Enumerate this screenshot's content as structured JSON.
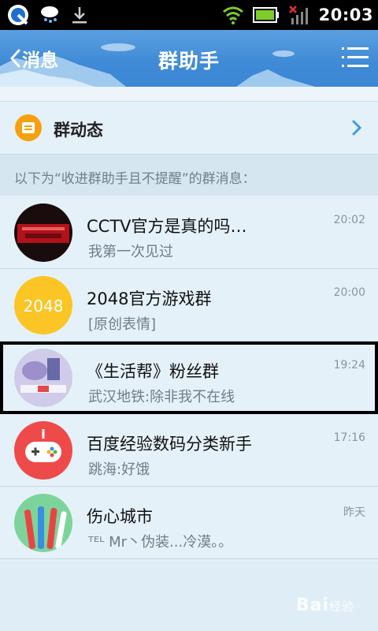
{
  "status_bar": {
    "time": "20:03",
    "icons": [
      "qq-icon",
      "weather-icon",
      "download-icon",
      "wifi-icon",
      "battery-icon",
      "no-sim-icon",
      "signal-icon"
    ]
  },
  "header": {
    "back_label": "消息",
    "title": "群助手"
  },
  "group_dynamics": {
    "label": "群动态"
  },
  "section_caption": "以下为“收进群助手且不提醒”的群消息：",
  "groups": [
    {
      "title": "CCTV官方是真的吗…",
      "subtitle": "我第一次见过",
      "time": "20:02",
      "avatar_color": "#8a0f14"
    },
    {
      "title": "2048官方游戏群",
      "subtitle": "[原创表情]",
      "time": "20:00",
      "avatar_color": "#fbc525",
      "avatar_text": "2048"
    },
    {
      "title": "《生活帮》粉丝群",
      "subtitle": "武汉地铁:除非我不在线",
      "time": "19:24",
      "avatar_color": "#c9c7e6",
      "selected": true
    },
    {
      "title": "百度经验数码分类新手",
      "subtitle": "跳海:好饿",
      "time": "17:16",
      "avatar_color": "#ef4a4a"
    },
    {
      "title": "伤心城市",
      "subtitle": "ᵀᴱᴸ Mr丶伪装...冷漠。。",
      "time": "昨天",
      "avatar_color": "#7dd49a"
    }
  ],
  "watermark": {
    "brand": "Bai",
    "suffix": "经验"
  },
  "colors": {
    "header_blue": "#3f8ad6",
    "row_bg": "#e5f1f9",
    "accent_orange": "#f5a10f"
  }
}
